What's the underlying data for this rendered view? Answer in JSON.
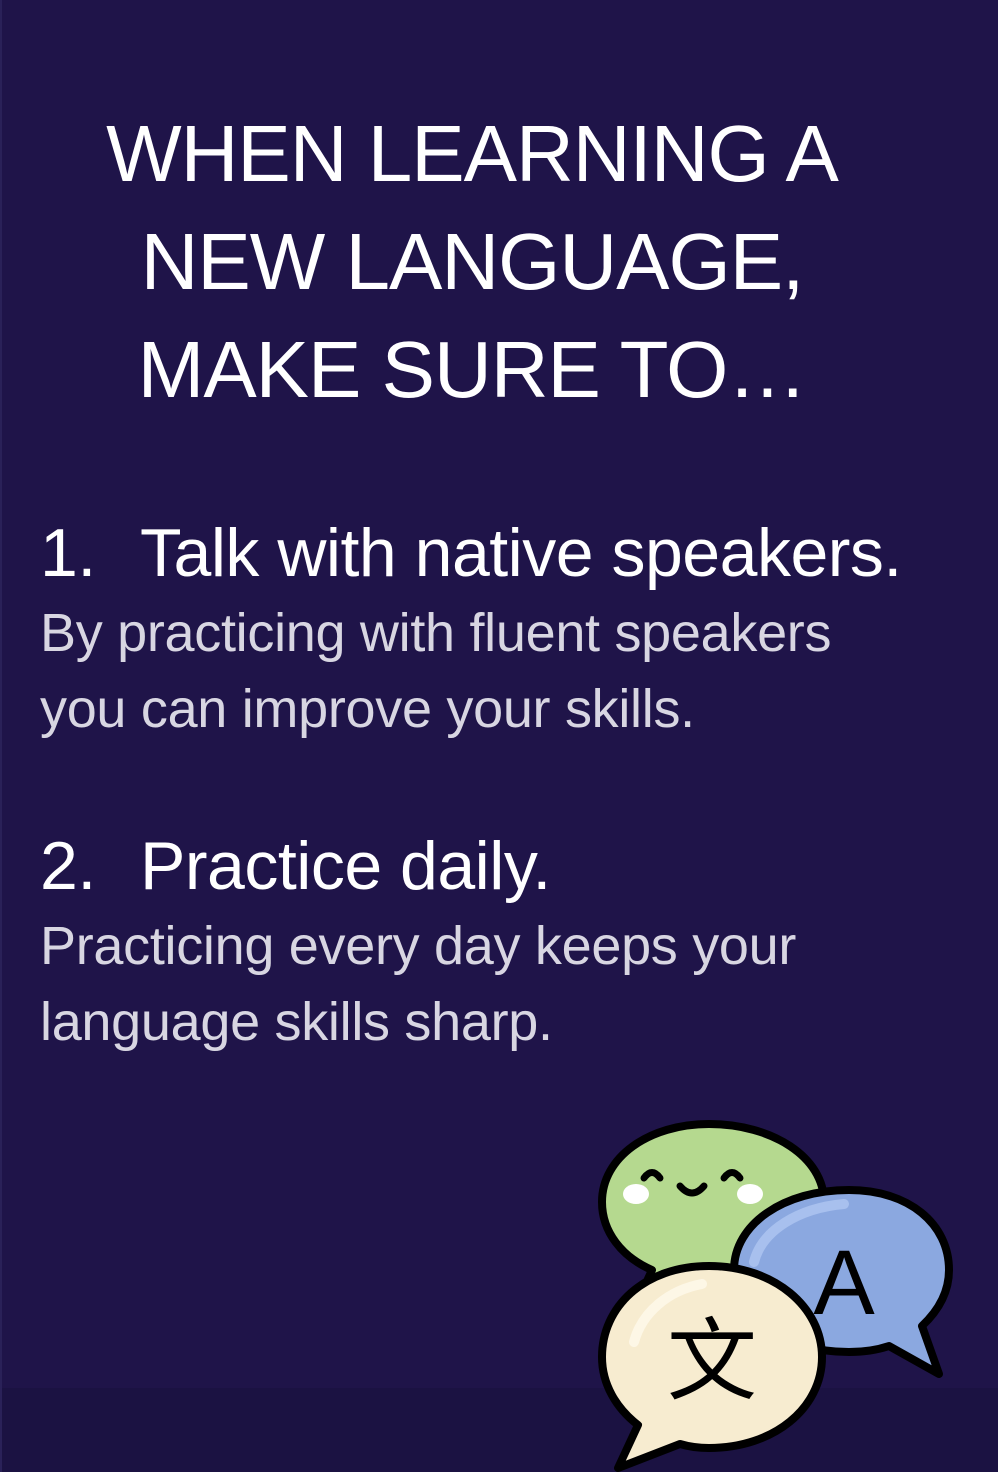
{
  "title": {
    "line1": "WHEN LEARNING A",
    "line2": "NEW LANGUAGE,",
    "line3": "MAKE SURE TO…"
  },
  "tips": [
    {
      "number": "1.",
      "heading": "Talk with native speakers.",
      "body_line1": "By practicing with fluent speakers",
      "body_line2": "you can improve your skills."
    },
    {
      "number": "2.",
      "heading": "Practice daily.",
      "body_line1": "Practicing every day keeps your",
      "body_line2": "language skills sharp."
    }
  ],
  "illustration": {
    "icon": "language-chat-bubbles-icon",
    "letter_a": "A",
    "glyph_wen": "文",
    "colors": {
      "green_bubble": "#b5d98f",
      "blue_bubble": "#8ba8e0",
      "cream_bubble": "#f7ecd0",
      "outline": "#000000"
    }
  },
  "colors": {
    "background": "#1f1449",
    "heading_text": "#ffffff",
    "body_text": "#d8d6e2"
  }
}
